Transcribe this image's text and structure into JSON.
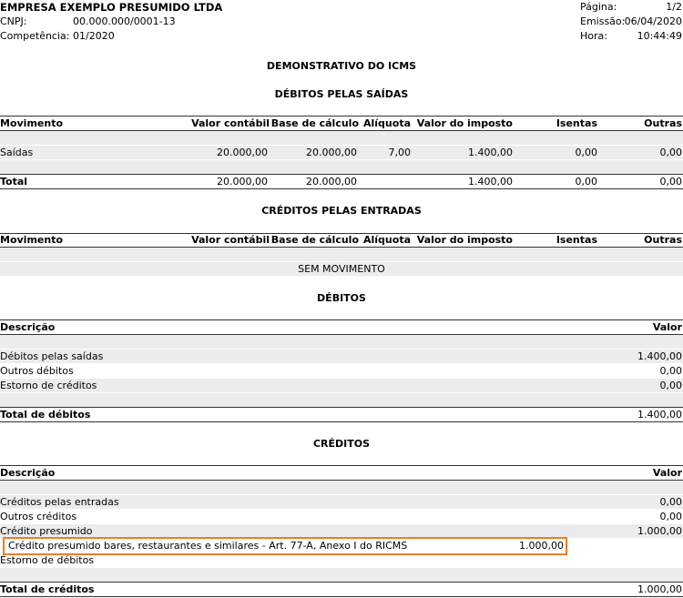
{
  "header": {
    "company": "EMPRESA EXEMPLO PRESUMIDO LTDA",
    "cnpj_label": "CNPJ:",
    "cnpj": "00.000.000/0001-13",
    "competencia_label": "Competência:",
    "competencia": "01/2020",
    "pagina_label": "Página:",
    "pagina": "1/2",
    "emissao_label": "Emissão:",
    "emissao": "06/04/2020",
    "hora_label": "Hora:",
    "hora": "10:44:49"
  },
  "title": "DEMONSTRATIVO DO ICMS",
  "debitos_saidas": {
    "title": "DÉBITOS PELAS SAÍDAS",
    "columns": [
      "Movimento",
      "Valor contábil",
      "Base de cálculo",
      "Alíquota",
      "Valor do imposto",
      "Isentas",
      "Outras"
    ],
    "row": [
      "Saídas",
      "20.000,00",
      "20.000,00",
      "7,00",
      "1.400,00",
      "0,00",
      "0,00"
    ],
    "total": [
      "Total",
      "20.000,00",
      "20.000,00",
      "",
      "1.400,00",
      "0,00",
      "0,00"
    ]
  },
  "creditos_entradas": {
    "title": "CRÉDITOS PELAS ENTRADAS",
    "columns": [
      "Movimento",
      "Valor contábil",
      "Base de cálculo",
      "Alíquota",
      "Valor do imposto",
      "Isentas",
      "Outras"
    ],
    "empty": "SEM MOVIMENTO"
  },
  "debitos": {
    "title": "DÉBITOS",
    "col_desc": "Descrição",
    "col_valor": "Valor",
    "rows": [
      {
        "desc": "Débitos pelas saídas",
        "valor": "1.400,00"
      },
      {
        "desc": "Outros débitos",
        "valor": "0,00"
      },
      {
        "desc": "Estorno de créditos",
        "valor": "0,00"
      }
    ],
    "total_label": "Total de débitos",
    "total": "1.400,00"
  },
  "creditos": {
    "title": "CRÉDITOS",
    "col_desc": "Descrição",
    "col_valor": "Valor",
    "rows": [
      {
        "desc": "Créditos pelas entradas",
        "valor": "0,00"
      },
      {
        "desc": "Outros créditos",
        "valor": "0,00"
      },
      {
        "desc": "Crédito presumido",
        "valor": "1.000,00"
      }
    ],
    "detail": {
      "desc": "Crédito presumido bares, restaurantes e similares - Art. 77-A, Anexo I do RICMS",
      "valor": "1.000,00"
    },
    "estorno": {
      "desc": "Estorno de débitos",
      "valor": ""
    },
    "total_label": "Total de créditos",
    "total": "1.000,00"
  },
  "colors": {
    "highlight": "#f07c22",
    "band": "#ececec"
  }
}
